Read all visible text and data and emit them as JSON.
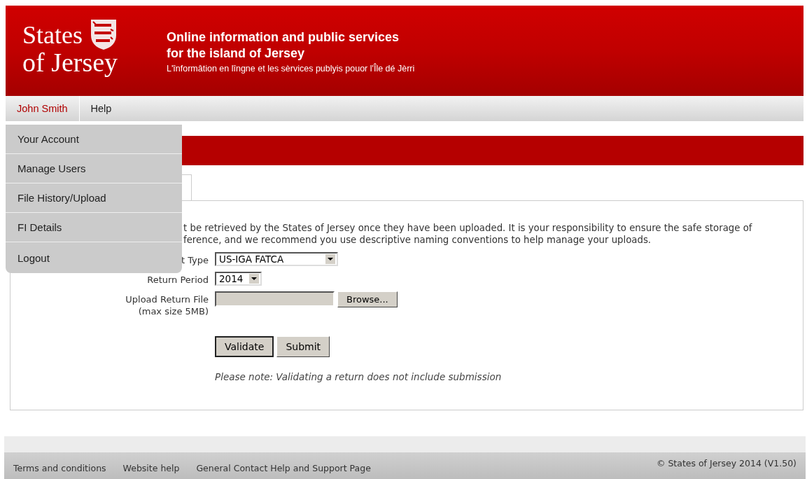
{
  "header": {
    "logo_lines": [
      "States",
      "of Jersey"
    ],
    "title_lines": [
      "Online information and public services",
      "for the island of Jersey"
    ],
    "subtitle": "L'înformâtion en lîngne et les sèrvices publyis pouor l'Île dé Jèrri"
  },
  "nav": [
    {
      "label": "John Smith",
      "selected": true
    },
    {
      "label": "Help",
      "selected": false
    }
  ],
  "menu": [
    {
      "label": "Your Account"
    },
    {
      "label": "Manage Users"
    },
    {
      "label": "File History/Upload"
    },
    {
      "label": "FI Details"
    },
    {
      "label": "Logout"
    }
  ],
  "notice_lines": [
    "t be retrieved by the States of Jersey once they have been uploaded. It is your responsibility to ensure the safe storage of",
    "ference, and we recommend you use descriptive naming conventions to help manage your uploads."
  ],
  "form": {
    "fields": [
      {
        "kind": "select",
        "label_lines": [
          "t Type"
        ],
        "value": "US-IGA FATCA"
      },
      {
        "kind": "select",
        "label_lines": [
          "Return Period"
        ],
        "value": "2014"
      },
      {
        "kind": "file",
        "label_lines": [
          "Upload Return File",
          "(max size 5MB)"
        ],
        "button": "Browse..."
      }
    ],
    "buttons": [
      {
        "label": "Validate",
        "focused": true
      },
      {
        "label": "Submit",
        "focused": false
      }
    ],
    "note": "Please note: Validating a return does not include submission"
  },
  "footer": {
    "links": [
      "Terms and conditions",
      "Website help",
      "General Contact Help and Support Page"
    ],
    "copyright": "© States of Jersey 2014 (V1.50)"
  }
}
